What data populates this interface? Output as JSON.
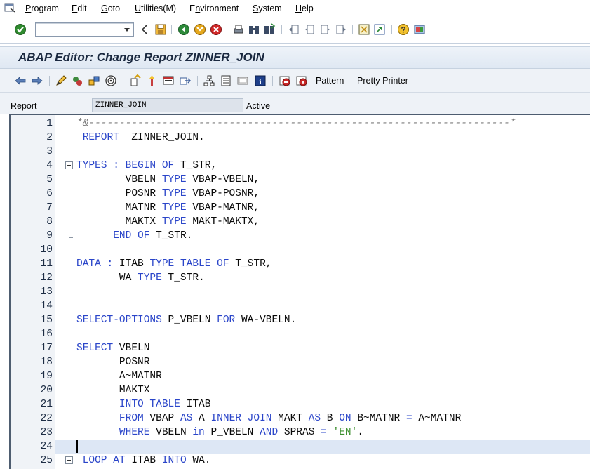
{
  "menu": {
    "items": [
      {
        "label": "Program",
        "u": "P"
      },
      {
        "label": "Edit",
        "u": "E"
      },
      {
        "label": "Goto",
        "u": "G"
      },
      {
        "label": "Utilities(M)",
        "u": "U"
      },
      {
        "label": "Environment",
        "u": "n"
      },
      {
        "label": "System",
        "u": "S"
      },
      {
        "label": "Help",
        "u": "H"
      }
    ]
  },
  "toolbar": {
    "command_field_value": "",
    "icons": [
      "enter-icon",
      "back-icon",
      "save-icon",
      "green-back-icon",
      "exit-icon",
      "cancel-icon",
      "print-icon",
      "find-icon",
      "find-next-icon",
      "first-page-icon",
      "previous-page-icon",
      "next-page-icon",
      "last-page-icon",
      "create-session-icon",
      "shortcut-icon",
      "help-icon",
      "customize-layout-icon"
    ]
  },
  "title": "ABAP Editor: Change Report ZINNER_JOIN",
  "app_toolbar": {
    "icons": [
      "back-arrow-icon",
      "forward-arrow-icon",
      "display-change-icon",
      "active-inactive-icon",
      "other-object-icon",
      "check-icon",
      "activate-icon",
      "test-icon",
      "where-used-icon",
      "enhance-icon",
      "navigation-window-icon",
      "object-list-icon",
      "display-object-list-icon",
      "info-icon",
      "breakpoint-icon",
      "session-breakpoint-icon"
    ],
    "pattern_label": "Pattern",
    "pretty_printer_label": "Pretty Printer"
  },
  "report": {
    "label": "Report",
    "value": "ZINNER_JOIN",
    "status": "Active"
  },
  "editor": {
    "current_line": 24,
    "lines": [
      {
        "n": "1",
        "tokens": [
          {
            "t": "*&---------------------------------------------------------------------*",
            "c": "cm"
          }
        ],
        "indent": 0
      },
      {
        "n": "2",
        "tokens": [
          {
            "t": " "
          },
          {
            "t": "REPORT",
            "c": "kw"
          },
          {
            "t": "  ZINNER_JOIN."
          }
        ]
      },
      {
        "n": "3",
        "tokens": []
      },
      {
        "n": "4",
        "tokens": [
          {
            "t": "TYPES",
            "c": "kw"
          },
          {
            "t": " "
          },
          {
            "t": ":",
            "c": "kw"
          },
          {
            "t": " "
          },
          {
            "t": "BEGIN OF",
            "c": "kw"
          },
          {
            "t": " T_STR,"
          }
        ]
      },
      {
        "n": "5",
        "tokens": [
          {
            "t": "        VBELN "
          },
          {
            "t": "TYPE",
            "c": "kw"
          },
          {
            "t": " VBAP-VBELN,"
          }
        ]
      },
      {
        "n": "6",
        "tokens": [
          {
            "t": "        POSNR "
          },
          {
            "t": "TYPE",
            "c": "kw"
          },
          {
            "t": " VBAP-POSNR,"
          }
        ]
      },
      {
        "n": "7",
        "tokens": [
          {
            "t": "        MATNR "
          },
          {
            "t": "TYPE",
            "c": "kw"
          },
          {
            "t": " VBAP-MATNR,"
          }
        ]
      },
      {
        "n": "8",
        "tokens": [
          {
            "t": "        MAKTX "
          },
          {
            "t": "TYPE",
            "c": "kw"
          },
          {
            "t": " MAKT-MAKTX,"
          }
        ]
      },
      {
        "n": "9",
        "tokens": [
          {
            "t": "      "
          },
          {
            "t": "END OF",
            "c": "kw"
          },
          {
            "t": " T_STR."
          }
        ]
      },
      {
        "n": "10",
        "tokens": []
      },
      {
        "n": "11",
        "tokens": [
          {
            "t": "DATA",
            "c": "kw"
          },
          {
            "t": " "
          },
          {
            "t": ":",
            "c": "kw"
          },
          {
            "t": " ITAB "
          },
          {
            "t": "TYPE TABLE OF",
            "c": "kw"
          },
          {
            "t": " T_STR,"
          }
        ]
      },
      {
        "n": "12",
        "tokens": [
          {
            "t": "       WA "
          },
          {
            "t": "TYPE",
            "c": "kw"
          },
          {
            "t": " T_STR."
          }
        ]
      },
      {
        "n": "13",
        "tokens": []
      },
      {
        "n": "14",
        "tokens": []
      },
      {
        "n": "15",
        "tokens": [
          {
            "t": "SELECT-OPTIONS",
            "c": "kw"
          },
          {
            "t": " P_VBELN "
          },
          {
            "t": "FOR",
            "c": "kw"
          },
          {
            "t": " WA-VBELN."
          }
        ]
      },
      {
        "n": "16",
        "tokens": []
      },
      {
        "n": "17",
        "tokens": [
          {
            "t": "SELECT",
            "c": "kw"
          },
          {
            "t": " VBELN"
          }
        ]
      },
      {
        "n": "18",
        "tokens": [
          {
            "t": "       POSNR"
          }
        ]
      },
      {
        "n": "19",
        "tokens": [
          {
            "t": "       A~MATNR"
          }
        ]
      },
      {
        "n": "20",
        "tokens": [
          {
            "t": "       MAKTX"
          }
        ]
      },
      {
        "n": "21",
        "tokens": [
          {
            "t": "       "
          },
          {
            "t": "INTO TABLE",
            "c": "kw"
          },
          {
            "t": " ITAB"
          }
        ]
      },
      {
        "n": "22",
        "tokens": [
          {
            "t": "       "
          },
          {
            "t": "FROM",
            "c": "kw"
          },
          {
            "t": " VBAP "
          },
          {
            "t": "AS",
            "c": "kw"
          },
          {
            "t": " A "
          },
          {
            "t": "INNER JOIN",
            "c": "kw"
          },
          {
            "t": " MAKT "
          },
          {
            "t": "AS",
            "c": "kw"
          },
          {
            "t": " B "
          },
          {
            "t": "ON",
            "c": "kw"
          },
          {
            "t": " B~MATNR "
          },
          {
            "t": "=",
            "c": "kw"
          },
          {
            "t": " A~MATNR"
          }
        ]
      },
      {
        "n": "23",
        "tokens": [
          {
            "t": "       "
          },
          {
            "t": "WHERE",
            "c": "kw"
          },
          {
            "t": " VBELN "
          },
          {
            "t": "in",
            "c": "kw"
          },
          {
            "t": " P_VBELN "
          },
          {
            "t": "AND",
            "c": "kw"
          },
          {
            "t": " SPRAS "
          },
          {
            "t": "=",
            "c": "kw"
          },
          {
            "t": " "
          },
          {
            "t": "'EN'",
            "c": "str"
          },
          {
            "t": "."
          }
        ]
      },
      {
        "n": "24",
        "tokens": []
      },
      {
        "n": "25",
        "tokens": [
          {
            "t": " "
          },
          {
            "t": "LOOP AT",
            "c": "kw"
          },
          {
            "t": " ITAB "
          },
          {
            "t": "INTO",
            "c": "kw"
          },
          {
            "t": " WA."
          }
        ]
      }
    ]
  }
}
